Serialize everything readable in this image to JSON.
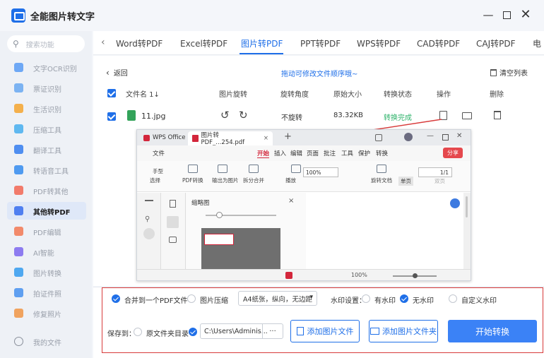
{
  "app": {
    "title": "全能图片转文字"
  },
  "sidebar": {
    "search_placeholder": "搜索功能",
    "items": [
      {
        "label": "文字OCR识别",
        "color": "#6ea8f5"
      },
      {
        "label": "票证识别",
        "color": "#7cb3f2"
      },
      {
        "label": "生活识别",
        "color": "#f4b04c"
      },
      {
        "label": "压缩工具",
        "color": "#5fb8f0"
      },
      {
        "label": "翻译工具",
        "color": "#4f8ef0"
      },
      {
        "label": "转语音工具",
        "color": "#4f9af0"
      },
      {
        "label": "PDF转其他",
        "color": "#f27b6b"
      },
      {
        "label": "其他转PDF",
        "color": "#4f7ff0"
      },
      {
        "label": "PDF编辑",
        "color": "#f28a6b"
      },
      {
        "label": "AI智能",
        "color": "#8d7bf0"
      },
      {
        "label": "图片转换",
        "color": "#4fa8f0"
      },
      {
        "label": "拍证件照",
        "color": "#5f9ff0"
      },
      {
        "label": "修复照片",
        "color": "#f0a35f"
      }
    ],
    "my_files": "我的文件"
  },
  "tabs": [
    "Word转PDF",
    "Excel转PDF",
    "图片转PDF",
    "PPT转PDF",
    "WPS转PDF",
    "CAD转PDF",
    "CAJ转PDF",
    "电"
  ],
  "toolbar": {
    "back": "返回",
    "hint": "拖动可修改文件顺序哦~",
    "clear": "清空列表"
  },
  "table": {
    "headers": [
      "文件名 1↓",
      "图片旋转",
      "旋转角度",
      "原始大小",
      "转换状态",
      "操作",
      "删除"
    ],
    "row": {
      "name": "11.jpg",
      "angle": "不旋转",
      "size": "83.32KB",
      "status": "转换完成"
    }
  },
  "wps": {
    "tabs": [
      "WPS Office",
      "图片转PDF_...254.pdf"
    ],
    "menu": [
      "文件",
      "开始",
      "插入",
      "编辑",
      "页面",
      "批注",
      "工具",
      "保护",
      "转换"
    ],
    "share": "分享",
    "ribbon": [
      "手型",
      "选择",
      "PDF转换",
      "输出为图片",
      "拆分合并",
      "播放",
      "旋转文档",
      "单页",
      "双页"
    ],
    "zoom": "100%",
    "page": "1/1",
    "thumb_title": "缩略图",
    "status_zoom": "100%"
  },
  "options": {
    "merge": "合并到一个PDF文件",
    "compress": "图片压缩",
    "paper": "A4纸张，纵向，无边距",
    "watermark_label": "水印设置：",
    "wm_yes": "有水印",
    "wm_no": "无水印",
    "wm_custom": "自定义水印",
    "save_label": "保存到：",
    "save_original": "原文件夹目录",
    "save_path": "C:\\Users\\Adminis...",
    "more": "···",
    "add_file": "添加图片文件",
    "add_folder": "添加图片文件夹",
    "start": "开始转换"
  },
  "colors": {
    "accent": "#1f6fe8",
    "highlight": "#d83b3b",
    "success": "#2fb36b",
    "wps_red": "#d3263b"
  }
}
